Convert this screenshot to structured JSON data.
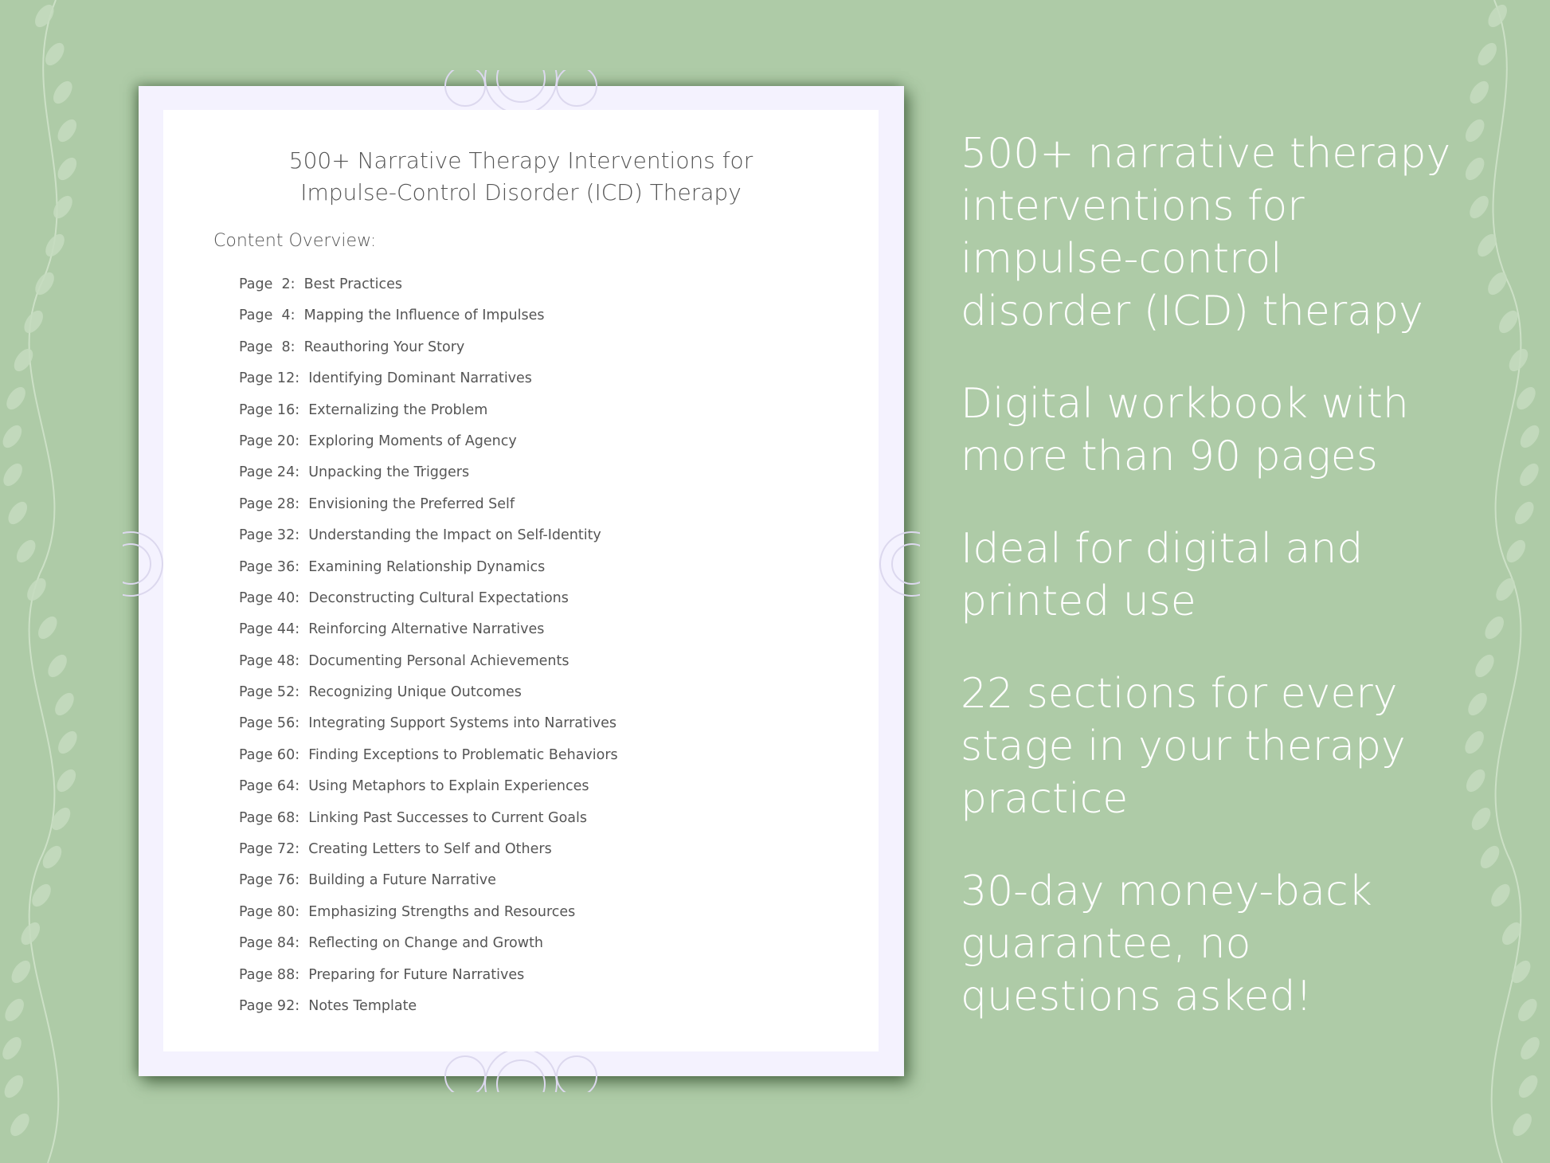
{
  "document": {
    "title_line1": "500+ Narrative Therapy Interventions for",
    "title_line2": "Impulse-Control Disorder (ICD) Therapy",
    "overview_label": "Content Overview:",
    "toc": [
      {
        "page": "Page  2:",
        "label": "Best Practices"
      },
      {
        "page": "Page  4:",
        "label": "Mapping the Influence of Impulses"
      },
      {
        "page": "Page  8:",
        "label": "Reauthoring Your Story"
      },
      {
        "page": "Page 12:",
        "label": "Identifying Dominant Narratives"
      },
      {
        "page": "Page 16:",
        "label": "Externalizing the Problem"
      },
      {
        "page": "Page 20:",
        "label": "Exploring Moments of Agency"
      },
      {
        "page": "Page 24:",
        "label": "Unpacking the Triggers"
      },
      {
        "page": "Page 28:",
        "label": "Envisioning the Preferred Self"
      },
      {
        "page": "Page 32:",
        "label": "Understanding the Impact on Self-Identity"
      },
      {
        "page": "Page 36:",
        "label": "Examining Relationship Dynamics"
      },
      {
        "page": "Page 40:",
        "label": "Deconstructing Cultural Expectations"
      },
      {
        "page": "Page 44:",
        "label": "Reinforcing Alternative Narratives"
      },
      {
        "page": "Page 48:",
        "label": "Documenting Personal Achievements"
      },
      {
        "page": "Page 52:",
        "label": "Recognizing Unique Outcomes"
      },
      {
        "page": "Page 56:",
        "label": "Integrating Support Systems into Narratives"
      },
      {
        "page": "Page 60:",
        "label": "Finding Exceptions to Problematic Behaviors"
      },
      {
        "page": "Page 64:",
        "label": "Using Metaphors to Explain Experiences"
      },
      {
        "page": "Page 68:",
        "label": "Linking Past Successes to Current Goals"
      },
      {
        "page": "Page 72:",
        "label": "Creating Letters to Self and Others"
      },
      {
        "page": "Page 76:",
        "label": "Building a Future Narrative"
      },
      {
        "page": "Page 80:",
        "label": "Emphasizing Strengths and Resources"
      },
      {
        "page": "Page 84:",
        "label": "Reflecting on Change and Growth"
      },
      {
        "page": "Page 88:",
        "label": "Preparing for Future Narratives"
      },
      {
        "page": "Page 92:",
        "label": "Notes Template"
      }
    ]
  },
  "features": [
    {
      "lines": [
        "500+ narrative therapy",
        "interventions for",
        "impulse-control",
        "disorder (ICD) therapy"
      ]
    },
    {
      "lines": [
        "Digital workbook with",
        "more than 90 pages"
      ]
    },
    {
      "lines": [
        "Ideal for digital and",
        "printed use"
      ]
    },
    {
      "lines": [
        "22 sections for every",
        "stage in your therapy",
        "practice"
      ]
    },
    {
      "lines": [
        "30-day money-back",
        "guarantee, no",
        "questions asked!"
      ]
    }
  ],
  "colors": {
    "background": "#aecba7",
    "page_border": "#f4f2fe",
    "text_dark": "#555555",
    "text_light": "#ffffff"
  }
}
